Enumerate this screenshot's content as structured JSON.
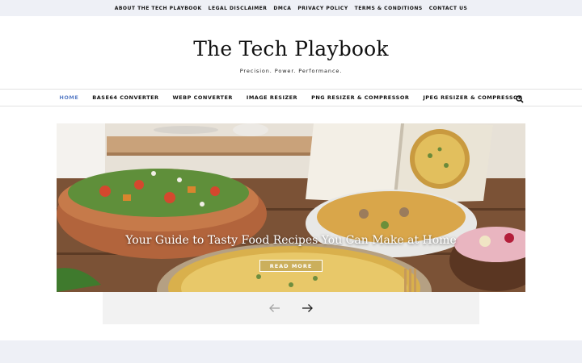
{
  "top_menu": {
    "items": [
      {
        "label": "ABOUT THE TECH PLAYBOOK"
      },
      {
        "label": "LEGAL DISCLAIMER"
      },
      {
        "label": "DMCA"
      },
      {
        "label": "PRIVACY POLICY"
      },
      {
        "label": "TERMS & CONDITIONS"
      },
      {
        "label": "CONTACT US"
      }
    ]
  },
  "site": {
    "title": "The Tech Playbook",
    "tagline": "Precision. Power. Performance."
  },
  "main_nav": {
    "items": [
      {
        "label": "HOME",
        "active": true
      },
      {
        "label": "BASE64 CONVERTER"
      },
      {
        "label": "WEBP CONVERTER"
      },
      {
        "label": "IMAGE RESIZER"
      },
      {
        "label": "PNG RESIZER & COMPRESSOR"
      },
      {
        "label": "JPEG RESIZER & COMPRESSOR"
      }
    ],
    "search_icon": "search-icon",
    "active_color": "#5b7fc7"
  },
  "hero": {
    "title": "Your Guide to Tasty Food Recipes You Can Make at Home",
    "button_label": "READ MORE"
  },
  "slider": {
    "prev_icon": "arrow-left-icon",
    "next_icon": "arrow-right-icon"
  }
}
